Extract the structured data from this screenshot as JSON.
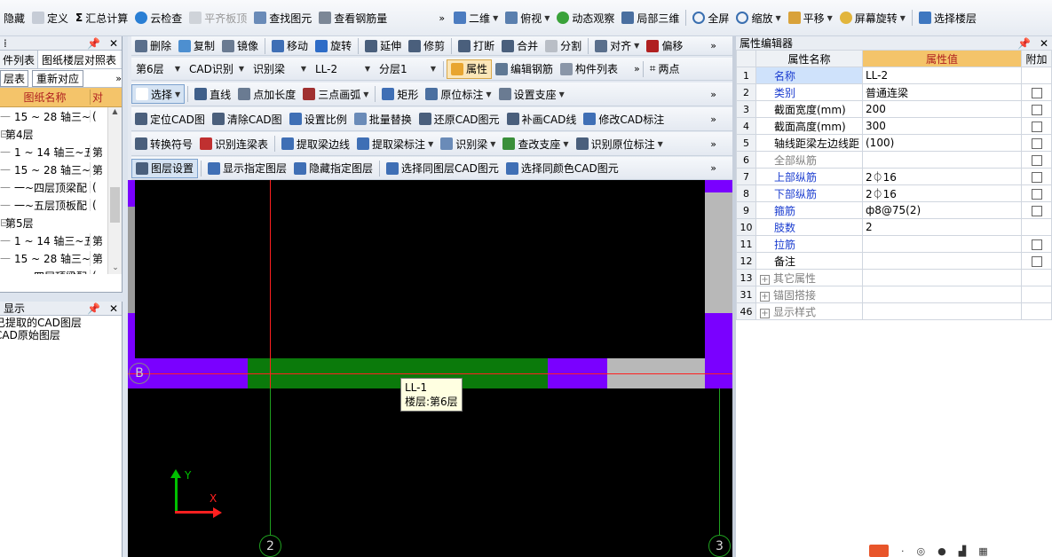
{
  "topbar": {
    "items": [
      {
        "label": "隐藏",
        "icon": "hide-icon",
        "enabled": true
      },
      {
        "label": "定义",
        "icon": "define-icon",
        "enabled": true
      },
      {
        "label": "汇总计算",
        "icon": "sigma-icon",
        "enabled": true
      },
      {
        "label": "云检查",
        "icon": "cloud-check-icon",
        "enabled": true
      },
      {
        "label": "平齐板顶",
        "icon": "align-slab-icon",
        "enabled": false
      },
      {
        "label": "查找图元",
        "icon": "find-element-icon",
        "enabled": true
      },
      {
        "label": "查看钢筋量",
        "icon": "rebar-view-icon",
        "enabled": true
      }
    ],
    "view_items": [
      {
        "label": "二维",
        "icon": "2d-icon"
      },
      {
        "label": "俯视",
        "icon": "top-view-icon"
      },
      {
        "label": "动态观察",
        "icon": "orbit-icon"
      },
      {
        "label": "局部三维",
        "icon": "local-3d-icon"
      },
      {
        "label": "全屏",
        "icon": "fullscreen-icon"
      },
      {
        "label": "缩放",
        "icon": "zoom-icon"
      },
      {
        "label": "平移",
        "icon": "pan-icon"
      },
      {
        "label": "屏幕旋转",
        "icon": "screen-rotate-icon"
      },
      {
        "label": "选择楼层",
        "icon": "select-floor-icon"
      }
    ]
  },
  "left_panel": {
    "tabs": [
      "件列表",
      "图纸楼层对照表"
    ],
    "sub_tabs": [
      "层表",
      "重新对应"
    ],
    "column_header": "图纸名称",
    "column_header2": "对",
    "rows": [
      {
        "name": "15 ~ 28 轴三~",
        "col2": "(",
        "indent": true
      },
      {
        "name": "第4层",
        "col2": "",
        "indent": false
      },
      {
        "name": "1 ~ 14 轴三~五",
        "col2": "第",
        "indent": true
      },
      {
        "name": "15 ~ 28 轴三~",
        "col2": "第",
        "indent": true
      },
      {
        "name": "一~四层顶梁配",
        "col2": "(",
        "indent": true
      },
      {
        "name": "一~五层顶板配",
        "col2": "(",
        "indent": true
      },
      {
        "name": "第5层",
        "col2": "",
        "indent": false
      },
      {
        "name": "1 ~ 14 轴三~五",
        "col2": "第",
        "indent": true
      },
      {
        "name": "15 ~ 28 轴三~",
        "col2": "第",
        "indent": true
      },
      {
        "name": "一~四层顶梁配",
        "col2": "(",
        "indent": true
      }
    ],
    "display_panel": {
      "title": "显示",
      "items": [
        "已提取的CAD图层",
        "CAD原始图层"
      ]
    }
  },
  "edit_toolbar": {
    "items": [
      "删除",
      "复制",
      "镜像",
      "移动",
      "旋转",
      "延伸",
      "修剪",
      "打断",
      "合并",
      "分割",
      "对齐",
      "偏移"
    ]
  },
  "selector_toolbar": {
    "floor": "第6层",
    "mode": "CAD识别",
    "element_type": "识别梁",
    "element_name": "LL-2",
    "layer": "分层1",
    "properties_label": "属性",
    "edit_rebar_label": "编辑钢筋",
    "component_list_label": "构件列表",
    "two_point_label": "两点"
  },
  "draw_toolbar": {
    "items": [
      "选择",
      "直线",
      "点加长度",
      "三点画弧",
      "矩形",
      "原位标注",
      "设置支座"
    ]
  },
  "cad_toolbar_1": {
    "items": [
      "定位CAD图",
      "清除CAD图",
      "设置比例",
      "批量替换",
      "还原CAD图元",
      "补画CAD线",
      "修改CAD标注"
    ]
  },
  "cad_toolbar_2": {
    "items": [
      "转换符号",
      "识别连梁表",
      "提取梁边线",
      "提取梁标注",
      "识别梁",
      "查改支座",
      "识别原位标注"
    ]
  },
  "cad_toolbar_3": {
    "items": [
      "图层设置",
      "显示指定图层",
      "隐藏指定图层",
      "选择同图层CAD图元",
      "选择同颜色CAD图元"
    ]
  },
  "canvas": {
    "axis_labels": {
      "row": "B",
      "col_left": "2",
      "col_right": "3"
    },
    "tooltip": {
      "name": "LL-1",
      "floor": "楼层:第6层"
    },
    "ucs": {
      "y": "Y",
      "x": "X"
    }
  },
  "property_editor": {
    "title": "属性编辑器",
    "headers": [
      "属性名称",
      "属性值",
      "附加"
    ],
    "rows": [
      {
        "no": "1",
        "name": "名称",
        "value": "LL-2",
        "style": "blue",
        "check": false,
        "selected": true
      },
      {
        "no": "2",
        "name": "类别",
        "value": "普通连梁",
        "style": "blue",
        "check": true
      },
      {
        "no": "3",
        "name": "截面宽度(mm)",
        "value": "200",
        "style": "normal",
        "check": true
      },
      {
        "no": "4",
        "name": "截面高度(mm)",
        "value": "300",
        "style": "normal",
        "check": true
      },
      {
        "no": "5",
        "name": "轴线距梁左边线距",
        "value": "(100)",
        "style": "normal",
        "check": true
      },
      {
        "no": "6",
        "name": "全部纵筋",
        "value": "",
        "style": "gray",
        "check": true
      },
      {
        "no": "7",
        "name": "上部纵筋",
        "value": "2⏀16",
        "style": "blue",
        "check": true
      },
      {
        "no": "8",
        "name": "下部纵筋",
        "value": "2⏀16",
        "style": "blue",
        "check": true
      },
      {
        "no": "9",
        "name": "箍筋",
        "value": "ф8@75(2)",
        "style": "blue",
        "check": true
      },
      {
        "no": "10",
        "name": "肢数",
        "value": "2",
        "style": "blue",
        "check": false
      },
      {
        "no": "11",
        "name": "拉筋",
        "value": "",
        "style": "blue",
        "check": true
      },
      {
        "no": "12",
        "name": "备注",
        "value": "",
        "style": "normal",
        "check": true
      },
      {
        "no": "13",
        "name": "其它属性",
        "value": "",
        "style": "group",
        "check": false
      },
      {
        "no": "31",
        "name": "锚固搭接",
        "value": "",
        "style": "group",
        "check": false
      },
      {
        "no": "46",
        "name": "显示样式",
        "value": "",
        "style": "group",
        "check": false
      }
    ]
  },
  "colors": {
    "canvas_bg": "#000000",
    "beam_green": "#0b7a0b",
    "beam_purple": "#7a00ff",
    "beam_gray": "#b8b8b8",
    "axis_red": "#ff2020",
    "axis_green": "#20a020",
    "header_orange": "#f4c46a"
  }
}
